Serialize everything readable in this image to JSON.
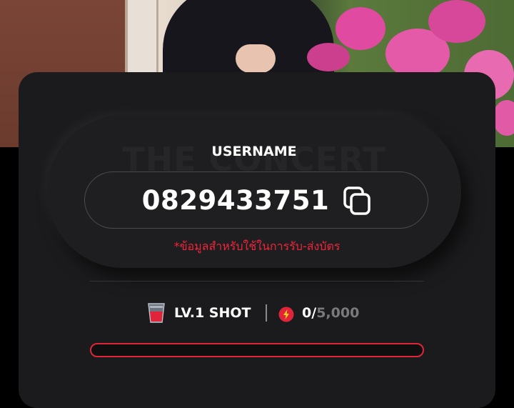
{
  "header": {
    "background_image": "concert-photo"
  },
  "profile": {
    "watermark": "THE CONCERT",
    "username_label": "USERNAME",
    "username": "0829433751",
    "copy_icon": "copy-icon",
    "note": "*ข้อมูลสำหรับใช้ในการรับ-ส่งบัตร"
  },
  "stats": {
    "level_icon": "shot-glass-icon",
    "level": "LV.1 SHOT",
    "points_icon": "lightning-icon",
    "points_current": "0",
    "points_slash": "/",
    "points_max": "5,000",
    "progress": 0.0
  },
  "colors": {
    "accent": "#e0243a",
    "card": "#1b1b1d",
    "text": "#ffffff",
    "muted": "#7a7a7d"
  }
}
